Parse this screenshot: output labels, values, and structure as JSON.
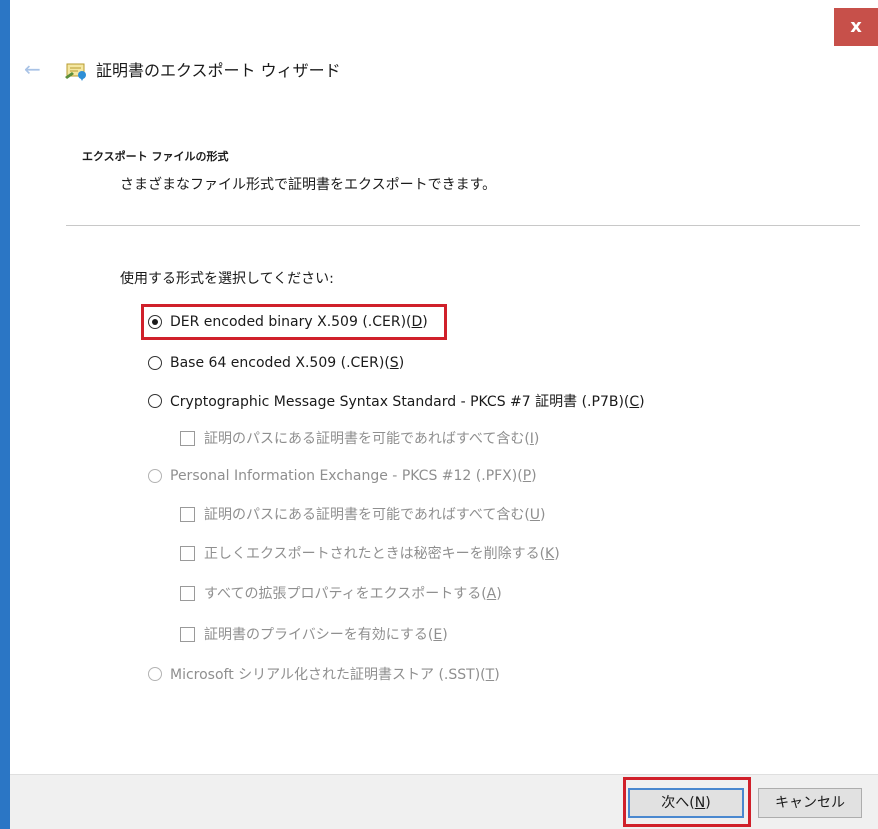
{
  "window": {
    "close_label": "x",
    "title": "証明書のエクスポート ウィザード"
  },
  "section": {
    "title": "エクスポート ファイルの形式",
    "description": "さまざまなファイル形式で証明書をエクスポートできます。"
  },
  "prompt": "使用する形式を選択してください:",
  "options": {
    "der": {
      "label": "DER encoded binary X.509 (.CER)(",
      "key": "D",
      "tail": ")",
      "checked": true,
      "enabled": true
    },
    "base64": {
      "label": "Base 64 encoded X.509 (.CER)(",
      "key": "S",
      "tail": ")",
      "checked": false,
      "enabled": true
    },
    "pkcs7": {
      "label": "Cryptographic Message Syntax Standard - PKCS #7 証明書 (.P7B)(",
      "key": "C",
      "tail": ")",
      "checked": false,
      "enabled": true
    },
    "pkcs7_include_all": {
      "label": "証明のパスにある証明書を可能であればすべて含む(",
      "key": "I",
      "tail": ")",
      "checked": false,
      "enabled": false
    },
    "pfx": {
      "label": "Personal Information Exchange - PKCS #12 (.PFX)(",
      "key": "P",
      "tail": ")",
      "checked": false,
      "enabled": false
    },
    "pfx_include_all": {
      "label": "証明のパスにある証明書を可能であればすべて含む(",
      "key": "U",
      "tail": ")",
      "checked": false,
      "enabled": false
    },
    "pfx_delete_key": {
      "label": "正しくエクスポートされたときは秘密キーを削除する(",
      "key": "K",
      "tail": ")",
      "checked": false,
      "enabled": false
    },
    "pfx_export_props": {
      "label": "すべての拡張プロパティをエクスポートする(",
      "key": "A",
      "tail": ")",
      "checked": false,
      "enabled": false
    },
    "pfx_privacy": {
      "label": "証明書のプライバシーを有効にする(",
      "key": "E",
      "tail": ")",
      "checked": false,
      "enabled": false
    },
    "sst": {
      "label": "Microsoft シリアル化された証明書ストア (.SST)(",
      "key": "T",
      "tail": ")",
      "checked": false,
      "enabled": false
    }
  },
  "buttons": {
    "next_label": "次へ(",
    "next_key": "N",
    "next_tail": ")",
    "cancel_label": "キャンセル"
  },
  "colors": {
    "title_bar_accent": "#2b76c5",
    "close_button": "#c7504a",
    "highlight_box": "#d0202a"
  }
}
